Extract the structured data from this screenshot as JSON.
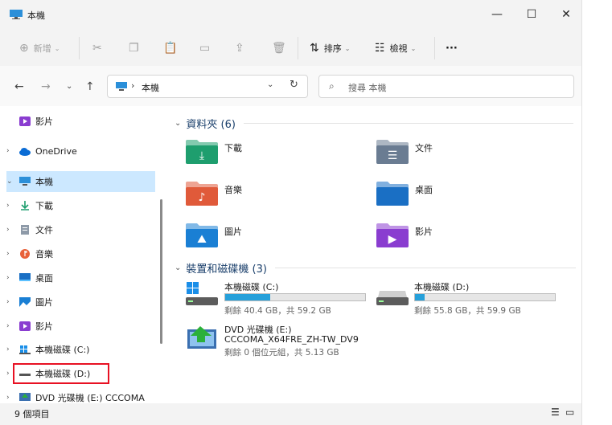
{
  "window": {
    "title": "本機"
  },
  "window_controls": {
    "minimize": "—",
    "maximize": "☐",
    "close": "✕"
  },
  "toolbar": {
    "new_label": "新增",
    "sort_label": "排序",
    "view_label": "檢視",
    "more_label": "···"
  },
  "address": {
    "path": "本機",
    "separator": "›"
  },
  "search": {
    "placeholder": "搜尋 本機"
  },
  "sidebar": {
    "items": [
      {
        "label": "影片",
        "icon": "videos-icon",
        "arrow": ""
      },
      {
        "label": "OneDrive",
        "icon": "onedrive-icon",
        "arrow": "›"
      },
      {
        "label": "本機",
        "icon": "computer-icon",
        "arrow": "⌄",
        "selected": true
      },
      {
        "label": "下載",
        "icon": "download-icon",
        "arrow": "›"
      },
      {
        "label": "文件",
        "icon": "documents-icon",
        "arrow": "›"
      },
      {
        "label": "音樂",
        "icon": "music-icon",
        "arrow": "›"
      },
      {
        "label": "桌面",
        "icon": "desktop-icon",
        "arrow": "›"
      },
      {
        "label": "圖片",
        "icon": "pictures-icon",
        "arrow": "›"
      },
      {
        "label": "影片",
        "icon": "videos-icon",
        "arrow": "›"
      },
      {
        "label": "本機磁碟 (C:)",
        "icon": "windows-drive-icon",
        "arrow": "›"
      },
      {
        "label": "本機磁碟 (D:)",
        "icon": "drive-icon",
        "arrow": "›",
        "highlighted": true
      },
      {
        "label": "DVD 光碟機 (E:) CCCOMA",
        "icon": "dvd-icon",
        "arrow": "›"
      }
    ]
  },
  "folders_group": {
    "title": "資料夾 (6)",
    "arrow": "⌄"
  },
  "folders": [
    {
      "name": "下載",
      "icon": "download-folder-icon",
      "color": "#1e9e6e"
    },
    {
      "name": "文件",
      "icon": "documents-folder-icon",
      "color": "#6a7c92"
    },
    {
      "name": "音樂",
      "icon": "music-folder-icon",
      "color": "#e05a3a"
    },
    {
      "name": "桌面",
      "icon": "desktop-folder-icon",
      "color": "#1a6fc4"
    },
    {
      "name": "圖片",
      "icon": "pictures-folder-icon",
      "color": "#1a7fd4"
    },
    {
      "name": "影片",
      "icon": "videos-folder-icon",
      "color": "#8a3dd0"
    }
  ],
  "devices_group": {
    "title": "裝置和磁碟機 (3)",
    "arrow": "⌄"
  },
  "drives": [
    {
      "name": "本機磁碟 (C:)",
      "free": "剩餘 40.4 GB，共 59.2 GB",
      "used_fraction": 0.32,
      "icon": "windows-drive-icon"
    },
    {
      "name": "本機磁碟 (D:)",
      "free": "剩餘 55.8 GB，共 59.9 GB",
      "used_fraction": 0.07,
      "icon": "drive-icon"
    }
  ],
  "dvd": {
    "name": "DVD 光碟機 (E:)",
    "label": "CCCOMA_X64FRE_ZH-TW_DV9",
    "free": "剩餘 0 個位元組，共 5.13 GB",
    "icon": "dvd-drive-icon"
  },
  "status": {
    "count": "9 個項目"
  },
  "colors": {
    "accent": "#0067c0",
    "selection": "#cce8ff",
    "highlight_box": "#e81123",
    "bar_fill": "#26a0da"
  }
}
